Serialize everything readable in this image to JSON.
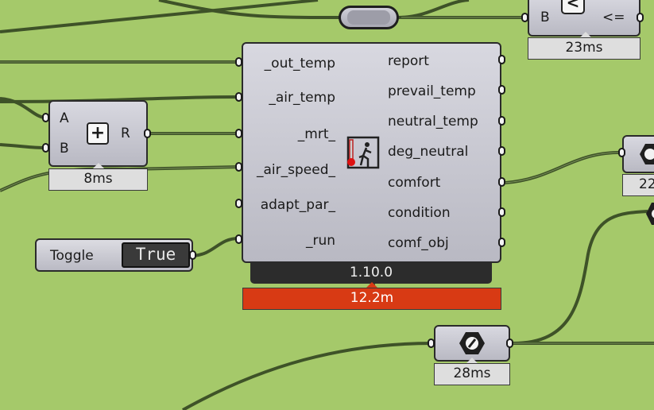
{
  "main_component": {
    "inputs": [
      "_out_temp",
      "_air_temp",
      "_mrt_",
      "_air_speed_",
      "adapt_par_",
      "_run"
    ],
    "outputs": [
      "report",
      "prevail_temp",
      "neutral_temp",
      "deg_neutral",
      "comfort",
      "condition",
      "comf_obj"
    ],
    "version": "1.10.0",
    "runtime": "12.2m",
    "icon": "thermometer-person-icon",
    "runtime_color": "#d83a14"
  },
  "addition": {
    "inputs": [
      "A",
      "B"
    ],
    "output": "R",
    "symbol": "+",
    "runtime": "8ms"
  },
  "compare": {
    "input": "B",
    "output": "<=",
    "symbol": "<",
    "runtime": "23ms"
  },
  "toggle": {
    "label": "Toggle",
    "value": "True"
  },
  "panel_param": {
    "runtime": "28ms",
    "icon": "hexagon-dot-icon"
  },
  "right_param": {
    "runtime": "22"
  },
  "canvas": {
    "background": "#a5c96a",
    "wire_color": "#3e5228"
  }
}
